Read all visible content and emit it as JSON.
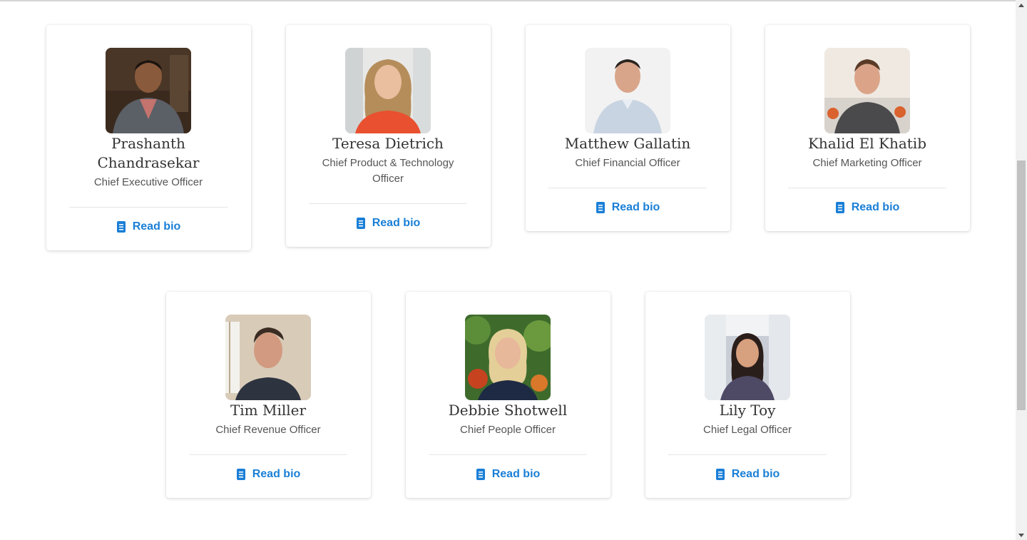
{
  "link_label": "Read bio",
  "accent_color": "#1a7fd6",
  "team_row_1": [
    {
      "name": "Prashanth Chandrasekar",
      "title": "Chief Executive Officer"
    },
    {
      "name": "Teresa Dietrich",
      "title": "Chief Product & Technology Officer"
    },
    {
      "name": "Matthew Gallatin",
      "title": "Chief Financial Officer"
    },
    {
      "name": "Khalid El Khatib",
      "title": "Chief Marketing Officer"
    }
  ],
  "team_row_2": [
    {
      "name": "Tim Miller",
      "title": "Chief Revenue Officer"
    },
    {
      "name": "Debbie Shotwell",
      "title": "Chief People Officer"
    },
    {
      "name": "Lily Toy",
      "title": "Chief Legal Officer"
    }
  ],
  "icons": {
    "bio_link_icon": "document-icon"
  }
}
